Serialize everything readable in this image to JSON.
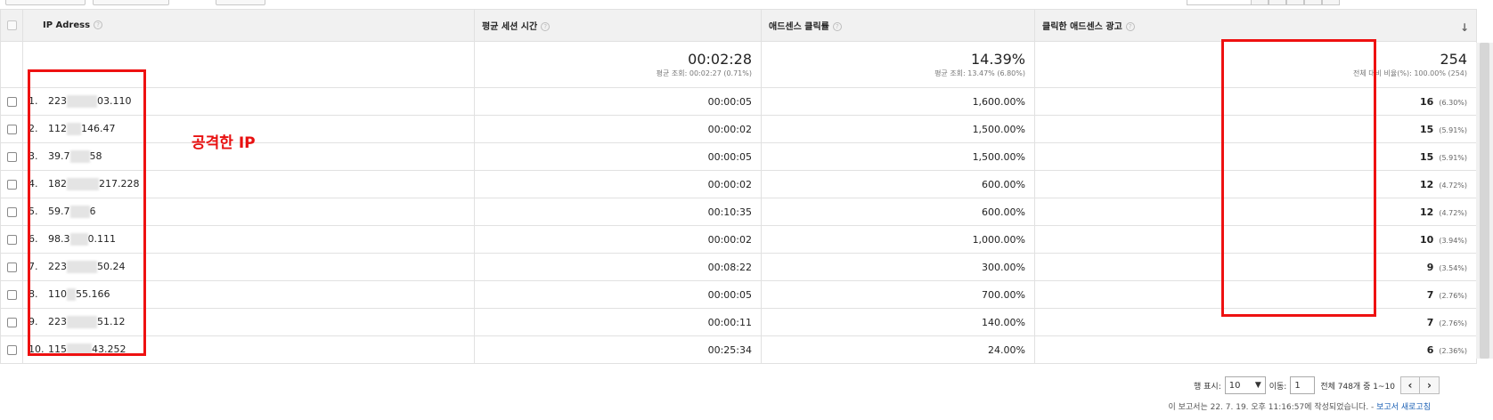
{
  "table": {
    "columns": [
      {
        "label": "IP Adress"
      },
      {
        "label": "평균 세션 시간"
      },
      {
        "label": "애드센스 클릭률"
      },
      {
        "label": "클릭한 애드센스 광고"
      }
    ],
    "totals": {
      "session": {
        "value": "00:02:28",
        "sub": "평균 조회: 00:02:27 (0.71%)"
      },
      "ctr": {
        "value": "14.39%",
        "sub": "평균 조회: 13.47% (6.80%)"
      },
      "clicks": {
        "value": "254",
        "sub": "전체 대비 비율(%): 100.00% (254)"
      }
    },
    "rows": [
      {
        "index": "1.",
        "ip_start": "223",
        "ip_end": "03.110",
        "session": "00:00:05",
        "ctr": "1,600.00%",
        "clicks": "16",
        "pct": "(6.30%)"
      },
      {
        "index": "2.",
        "ip_start": "112",
        "ip_end": "146.47",
        "session": "00:00:02",
        "ctr": "1,500.00%",
        "clicks": "15",
        "pct": "(5.91%)"
      },
      {
        "index": "3.",
        "ip_start": "39.7",
        "ip_end": "58",
        "session": "00:00:05",
        "ctr": "1,500.00%",
        "clicks": "15",
        "pct": "(5.91%)"
      },
      {
        "index": "4.",
        "ip_start": "182",
        "ip_end": "217.228",
        "session": "00:00:02",
        "ctr": "600.00%",
        "clicks": "12",
        "pct": "(4.72%)"
      },
      {
        "index": "5.",
        "ip_start": "59.7",
        "ip_end": "6",
        "session": "00:10:35",
        "ctr": "600.00%",
        "clicks": "12",
        "pct": "(4.72%)"
      },
      {
        "index": "6.",
        "ip_start": "98.3",
        "ip_end": "0.111",
        "session": "00:00:02",
        "ctr": "1,000.00%",
        "clicks": "10",
        "pct": "(3.94%)"
      },
      {
        "index": "7.",
        "ip_start": "223",
        "ip_end": "50.24",
        "session": "00:08:22",
        "ctr": "300.00%",
        "clicks": "9",
        "pct": "(3.54%)"
      },
      {
        "index": "8.",
        "ip_start": "110",
        "ip_end": "55.166",
        "session": "00:00:05",
        "ctr": "700.00%",
        "clicks": "7",
        "pct": "(2.76%)"
      },
      {
        "index": "9.",
        "ip_start": "223",
        "ip_end": "51.12",
        "session": "00:00:11",
        "ctr": "140.00%",
        "clicks": "7",
        "pct": "(2.76%)"
      },
      {
        "index": "10.",
        "ip_start": "115",
        "ip_end": "43.252",
        "session": "00:25:34",
        "ctr": "24.00%",
        "clicks": "6",
        "pct": "(2.36%)"
      }
    ]
  },
  "annotation": {
    "label": "공격한 IP",
    "color": "#ee1111"
  },
  "pager": {
    "show_label": "행 표시:",
    "show_value": "10",
    "goto_label": "이동:",
    "goto_value": "1",
    "range_text": "전체 748개 중 1~10"
  },
  "footer": {
    "text": "이 보고서는 22. 7. 19. 오후 11:16:57에 작성되었습니다. - ",
    "link": "보고서 새로고침"
  }
}
